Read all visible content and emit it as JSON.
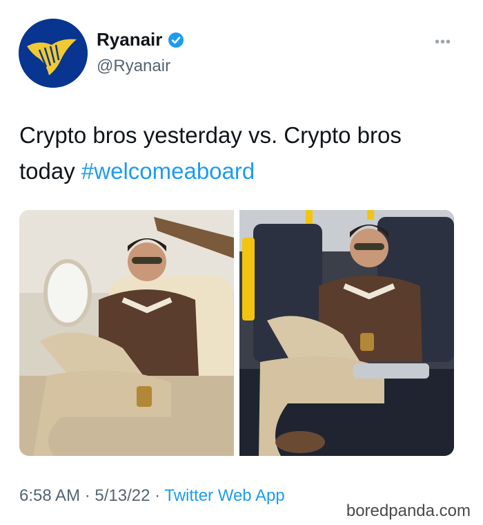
{
  "tweet": {
    "author_name": "Ryanair",
    "author_handle": "@Ryanair",
    "more_icon": "more-icon",
    "text_main": "Crypto bros yesterday vs. Crypto bros today ",
    "hashtag": "#welcomeaboard",
    "time": "6:58 AM",
    "separator": " · ",
    "date": "5/13/22",
    "source": "Twitter Web App"
  },
  "watermark": "boredpanda.com",
  "colors": {
    "link": "#1d9bf0",
    "brand": "#073590",
    "harp": "#f1c933"
  }
}
